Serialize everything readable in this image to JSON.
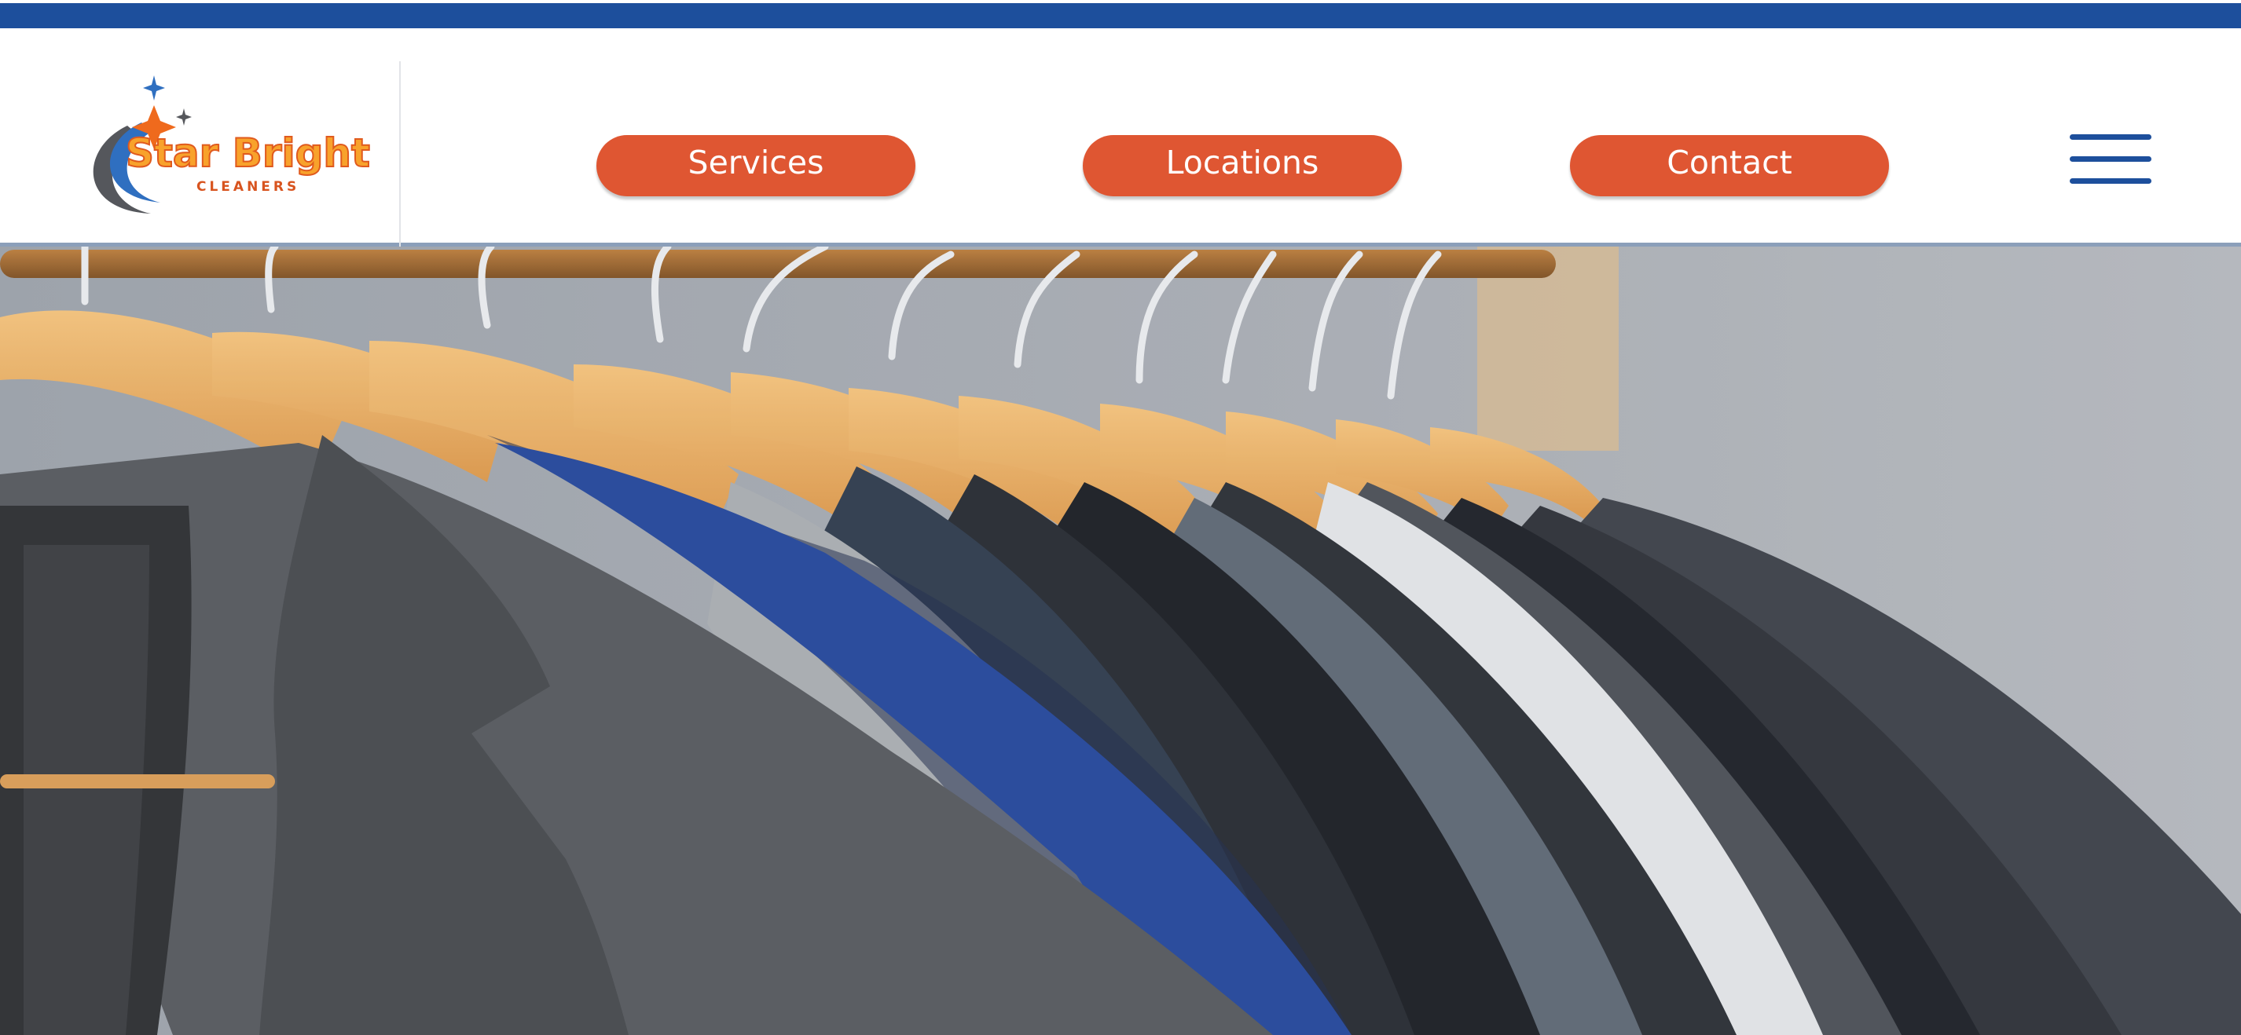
{
  "brand": {
    "name": "Star Bright",
    "tagline": "CLEANERS",
    "colors": {
      "blue": "#1d4f9c",
      "orange": "#df5632",
      "gold": "#f8a22b"
    }
  },
  "nav": {
    "items": [
      {
        "label": "Services"
      },
      {
        "label": "Locations"
      },
      {
        "label": "Contact"
      }
    ],
    "menu_icon": "hamburger-icon"
  },
  "hero": {
    "image": "suit jackets hanging on wooden hangers on a clothes rack"
  }
}
